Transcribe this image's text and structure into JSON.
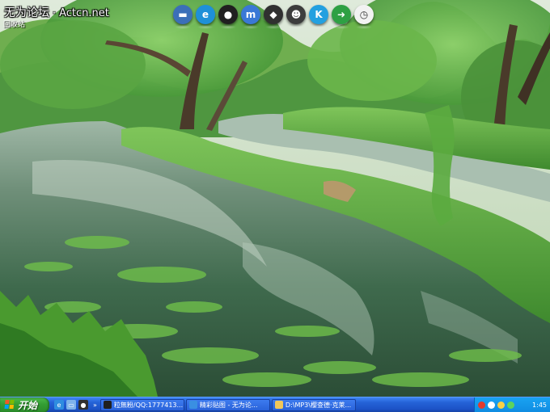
{
  "watermark": {
    "site_cn": "无为论坛",
    "separator": "·",
    "site_url": "Actcn.net"
  },
  "desktop_icons": [
    {
      "label": "回收站",
      "icon": "recycle-bin-icon"
    }
  ],
  "dock": {
    "items": [
      {
        "name": "dock-my-computer-icon",
        "glyph": "▬",
        "color": "#3b6fb8"
      },
      {
        "name": "dock-ie-icon",
        "glyph": "e",
        "color": "#1e90d8"
      },
      {
        "name": "dock-qq-penguin-icon",
        "glyph": "●",
        "color": "#202020"
      },
      {
        "name": "dock-network-icon",
        "glyph": "m",
        "color": "#3a78d6"
      },
      {
        "name": "dock-media-icon",
        "glyph": "◆",
        "color": "#303030"
      },
      {
        "name": "dock-panda-icon",
        "glyph": "☻",
        "color": "#3c3c3c"
      },
      {
        "name": "dock-kugou-icon",
        "glyph": "K",
        "color": "#23a0e0"
      },
      {
        "name": "dock-download-arrow-icon",
        "glyph": "➜",
        "color": "#2ea043"
      },
      {
        "name": "dock-clock-icon",
        "glyph": "◷",
        "color": "#f2f2f2"
      }
    ]
  },
  "taskbar": {
    "start_label": "开始",
    "quick_launch": [
      {
        "name": "quicklaunch-ie-icon",
        "color": "#2f8de0",
        "glyph": "e"
      },
      {
        "name": "quicklaunch-desktop-icon",
        "color": "#7fb3ea",
        "glyph": "▭"
      },
      {
        "name": "quicklaunch-app-icon",
        "color": "#303030",
        "glyph": "●"
      }
    ],
    "overflow_glyph": "»",
    "tasks": [
      {
        "label": "粒無粉/QQ:1777413...",
        "icon": "qq-task-icon",
        "color": "#202020"
      },
      {
        "label": "精彩贴图 - 无为论...",
        "icon": "ie-task-icon",
        "color": "#3a8fe2"
      },
      {
        "label": "D:\\MP3\\樱查德·克莱...",
        "icon": "folder-task-icon",
        "color": "#f1c75a"
      }
    ],
    "tray": {
      "icons": [
        {
          "name": "tray-qq-icon",
          "color": "#e23b2e"
        },
        {
          "name": "tray-network-icon",
          "color": "#ffffff"
        },
        {
          "name": "tray-volume-icon",
          "color": "#f7d046"
        },
        {
          "name": "tray-security-icon",
          "color": "#5dd35d"
        }
      ],
      "time": "1:45"
    }
  }
}
